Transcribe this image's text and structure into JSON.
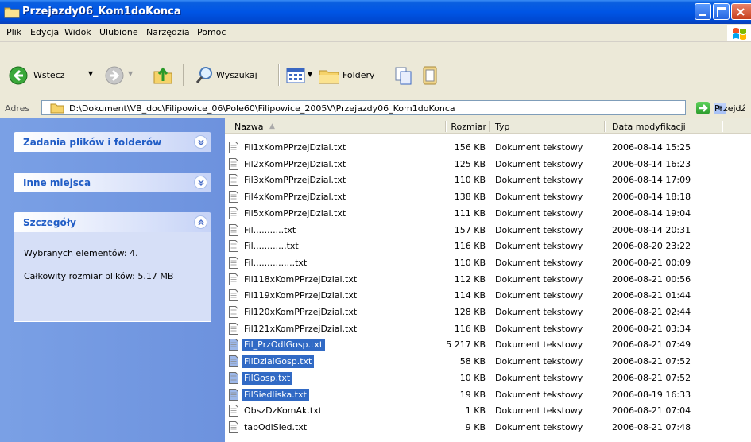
{
  "window": {
    "title": "Przejazdy06_Kom1doKonca"
  },
  "menu": [
    "Plik",
    "Edycja",
    "Widok",
    "Ulubione",
    "Narzędzia",
    "Pomoc"
  ],
  "toolbar": {
    "back": "Wstecz",
    "search": "Wyszukaj",
    "folders": "Foldery"
  },
  "address": {
    "label": "Adres",
    "path": "D:\\Dokument\\VB_doc\\Filipowice_06\\Pole60\\Filipowice_2005V\\Przejazdy06_Kom1doKonca",
    "go": "Przejdź"
  },
  "tasks": [
    {
      "title": "Zadania plików i folderów",
      "state": "collapsed"
    },
    {
      "title": "Inne miejsca",
      "state": "collapsed"
    },
    {
      "title": "Szczegóły",
      "state": "expanded",
      "lines": [
        "Wybranych elementów: 4.",
        "Całkowity rozmiar plików: 5.17 MB"
      ]
    }
  ],
  "columns": {
    "name": "Nazwa",
    "size": "Rozmiar",
    "type": "Typ",
    "date": "Data modyfikacji"
  },
  "files": [
    {
      "name": "Fil1xKomPPrzejDzial.txt",
      "size": "156 KB",
      "type": "Dokument tekstowy",
      "date": "2006-08-14 15:25",
      "selected": false
    },
    {
      "name": "Fil2xKomPPrzejDzial.txt",
      "size": "125 KB",
      "type": "Dokument tekstowy",
      "date": "2006-08-14 16:23",
      "selected": false
    },
    {
      "name": "Fil3xKomPPrzejDzial.txt",
      "size": "110 KB",
      "type": "Dokument tekstowy",
      "date": "2006-08-14 17:09",
      "selected": false
    },
    {
      "name": "Fil4xKomPPrzejDzial.txt",
      "size": "138 KB",
      "type": "Dokument tekstowy",
      "date": "2006-08-14 18:18",
      "selected": false
    },
    {
      "name": "Fil5xKomPPrzejDzial.txt",
      "size": "111 KB",
      "type": "Dokument tekstowy",
      "date": "2006-08-14 19:04",
      "selected": false
    },
    {
      "name": "Fil...........txt",
      "size": "157 KB",
      "type": "Dokument tekstowy",
      "date": "2006-08-14 20:31",
      "selected": false
    },
    {
      "name": "Fil............txt",
      "size": "116 KB",
      "type": "Dokument tekstowy",
      "date": "2006-08-20 23:22",
      "selected": false
    },
    {
      "name": "Fil...............txt",
      "size": "110 KB",
      "type": "Dokument tekstowy",
      "date": "2006-08-21 00:09",
      "selected": false
    },
    {
      "name": "Fil118xKomPPrzejDzial.txt",
      "size": "112 KB",
      "type": "Dokument tekstowy",
      "date": "2006-08-21 00:56",
      "selected": false
    },
    {
      "name": "Fil119xKomPPrzejDzial.txt",
      "size": "114 KB",
      "type": "Dokument tekstowy",
      "date": "2006-08-21 01:44",
      "selected": false
    },
    {
      "name": "Fil120xKomPPrzejDzial.txt",
      "size": "128 KB",
      "type": "Dokument tekstowy",
      "date": "2006-08-21 02:44",
      "selected": false
    },
    {
      "name": "Fil121xKomPPrzejDzial.txt",
      "size": "116 KB",
      "type": "Dokument tekstowy",
      "date": "2006-08-21 03:34",
      "selected": false
    },
    {
      "name": "Fil_PrzOdlGosp.txt",
      "size": "5 217 KB",
      "type": "Dokument tekstowy",
      "date": "2006-08-21 07:49",
      "selected": true
    },
    {
      "name": "FilDzialGosp.txt",
      "size": "58 KB",
      "type": "Dokument tekstowy",
      "date": "2006-08-21 07:52",
      "selected": true
    },
    {
      "name": "FilGosp.txt",
      "size": "10 KB",
      "type": "Dokument tekstowy",
      "date": "2006-08-21 07:52",
      "selected": true
    },
    {
      "name": "FilSiedliska.txt",
      "size": "19 KB",
      "type": "Dokument tekstowy",
      "date": "2006-08-19 16:33",
      "selected": true
    },
    {
      "name": "ObszDzKomAk.txt",
      "size": "1 KB",
      "type": "Dokument tekstowy",
      "date": "2006-08-21 07:04",
      "selected": false
    },
    {
      "name": "tabOdlSied.txt",
      "size": "9 KB",
      "type": "Dokument tekstowy",
      "date": "2006-08-21 07:48",
      "selected": false
    }
  ]
}
